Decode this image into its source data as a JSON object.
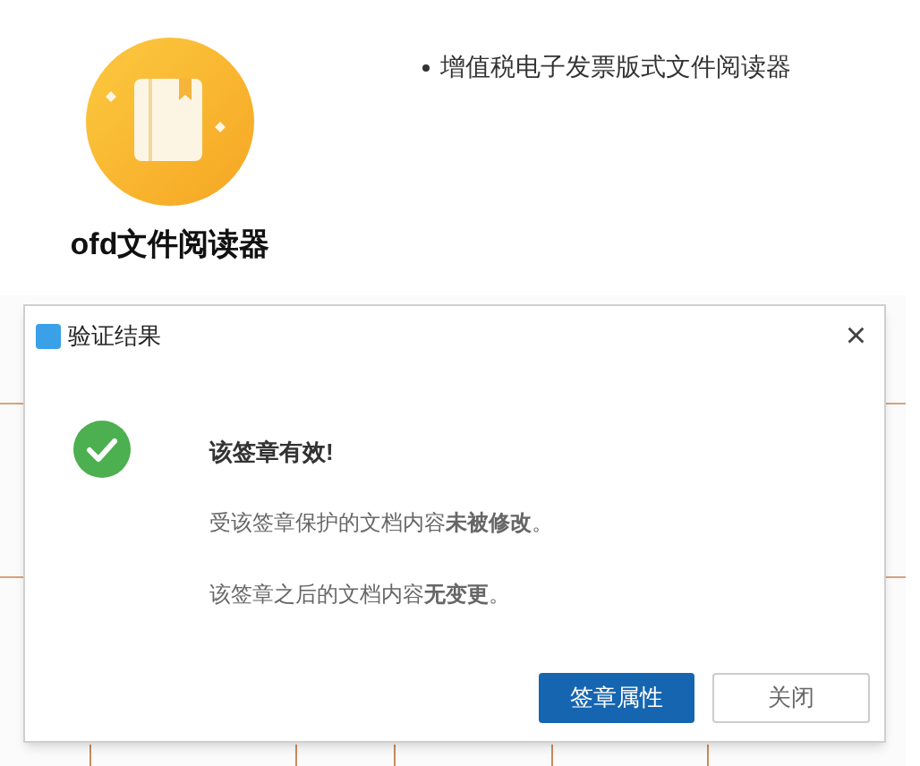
{
  "app": {
    "name": "ofd文件阅读器",
    "features": [
      "增值税电子发票版式文件阅读器"
    ]
  },
  "dialog": {
    "title": "验证结果",
    "close": "×",
    "valid": true,
    "heading": "该签章有效!",
    "messages": [
      "受该签章保护的文档内容**未被修改**。",
      "该签章之后的文档内容**无变更**。"
    ],
    "buttons": [
      {
        "label": "签章属性",
        "primary": true
      },
      {
        "label": "关闭",
        "primary": false
      }
    ]
  }
}
